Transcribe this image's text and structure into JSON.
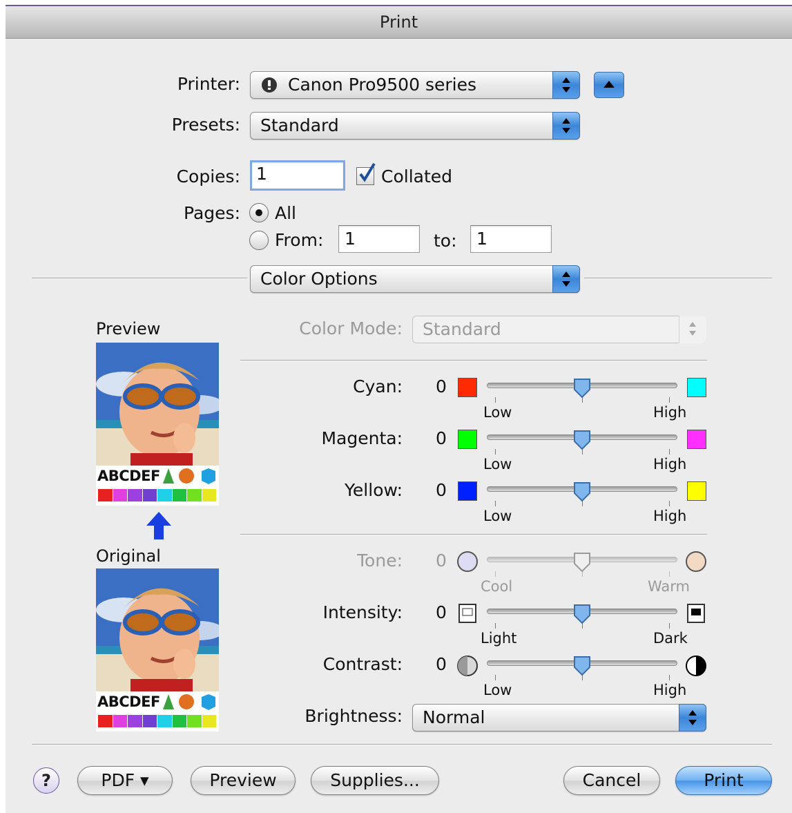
{
  "window": {
    "title": "Print"
  },
  "printer": {
    "label": "Printer:",
    "value": "Canon Pro9500 series"
  },
  "presets": {
    "label": "Presets:",
    "value": "Standard"
  },
  "copies": {
    "label": "Copies:",
    "value": "1",
    "collated_label": "Collated",
    "collated_checked": true
  },
  "pages": {
    "label": "Pages:",
    "all_label": "All",
    "from_label": "From:",
    "from_value": "1",
    "to_label": "to:",
    "to_value": "1",
    "selected": "all"
  },
  "panel_select": {
    "value": "Color Options"
  },
  "preview": {
    "preview_label": "Preview",
    "original_label": "Original",
    "sample_text": "ABCDEF",
    "color_bar": [
      "#e82020",
      "#e040e0",
      "#9c40e0",
      "#7040d0",
      "#20d0e8",
      "#20c040",
      "#70e020",
      "#e8e820"
    ]
  },
  "color_mode": {
    "label": "Color Mode:",
    "value": "Standard",
    "enabled": false
  },
  "sliders": {
    "cyan": {
      "label": "Cyan:",
      "value": "0",
      "low": "Low",
      "high": "High",
      "low_color": "#ff2a00",
      "high_color": "#00ffff"
    },
    "magenta": {
      "label": "Magenta:",
      "value": "0",
      "low": "Low",
      "high": "High",
      "low_color": "#00ff00",
      "high_color": "#ff30ff"
    },
    "yellow": {
      "label": "Yellow:",
      "value": "0",
      "low": "Low",
      "high": "High",
      "low_color": "#0020ff",
      "high_color": "#ffff00"
    },
    "tone": {
      "label": "Tone:",
      "value": "0",
      "low": "Cool",
      "high": "Warm",
      "enabled": false
    },
    "intensity": {
      "label": "Intensity:",
      "value": "0",
      "low": "Light",
      "high": "Dark"
    },
    "contrast": {
      "label": "Contrast:",
      "value": "0",
      "low": "Low",
      "high": "High"
    }
  },
  "brightness": {
    "label": "Brightness:",
    "value": "Normal"
  },
  "buttons": {
    "help": "?",
    "pdf": "PDF ▾",
    "preview": "Preview",
    "supplies": "Supplies...",
    "cancel": "Cancel",
    "print": "Print"
  },
  "colors": {
    "accent": "#3c86d8",
    "window_bg": "#ececec"
  }
}
